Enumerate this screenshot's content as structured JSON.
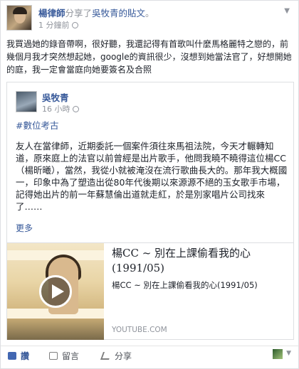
{
  "post": {
    "author": "楊律師",
    "action": "分享了",
    "target_link": "吳牧青的貼文",
    "action_end": "。",
    "time": "1 分鐘前",
    "text": "我買過她的錄音帶啊，很好聽，我還記得有首歌叫什麼馬格麗特之戀的，前幾個月我才突然想起她，google的資訊很少，沒想到她當法官了，好想開她的庭，我一定會當庭向她要簽名及合照"
  },
  "shared": {
    "author": "吳牧青",
    "time": "16 小時",
    "hashtag": "#數位考古",
    "body": "友人在當律師，近期委託一個案件須往來馬祖法院，今天才輾轉知道，原來庭上的法官以前曾經是出片歌手，他問我曉不曉得這位楊CC（楊昕曦），當然，我從小就被淹沒在流行歌曲長大的。那年我大概國一，印象中為了塑造出從80年代後期以來源源不絕的玉女歌手市場，記得她出片的前一年蘇慧倫出道就走紅，於是別家唱片公司找來了……",
    "more": "更多",
    "link": {
      "title": "楊CC ~ 別在上課偷看我的心 (1991/05)",
      "description": "楊CC ~ 別在上課偷看我的心(1991/05)",
      "domain": "YOUTUBE.COM"
    }
  },
  "actions": {
    "like": "讚",
    "comment": "留言",
    "share": "分享"
  },
  "colors": {
    "link_blue": "#365899",
    "meta_gray": "#90949c",
    "text": "#1d2129"
  }
}
